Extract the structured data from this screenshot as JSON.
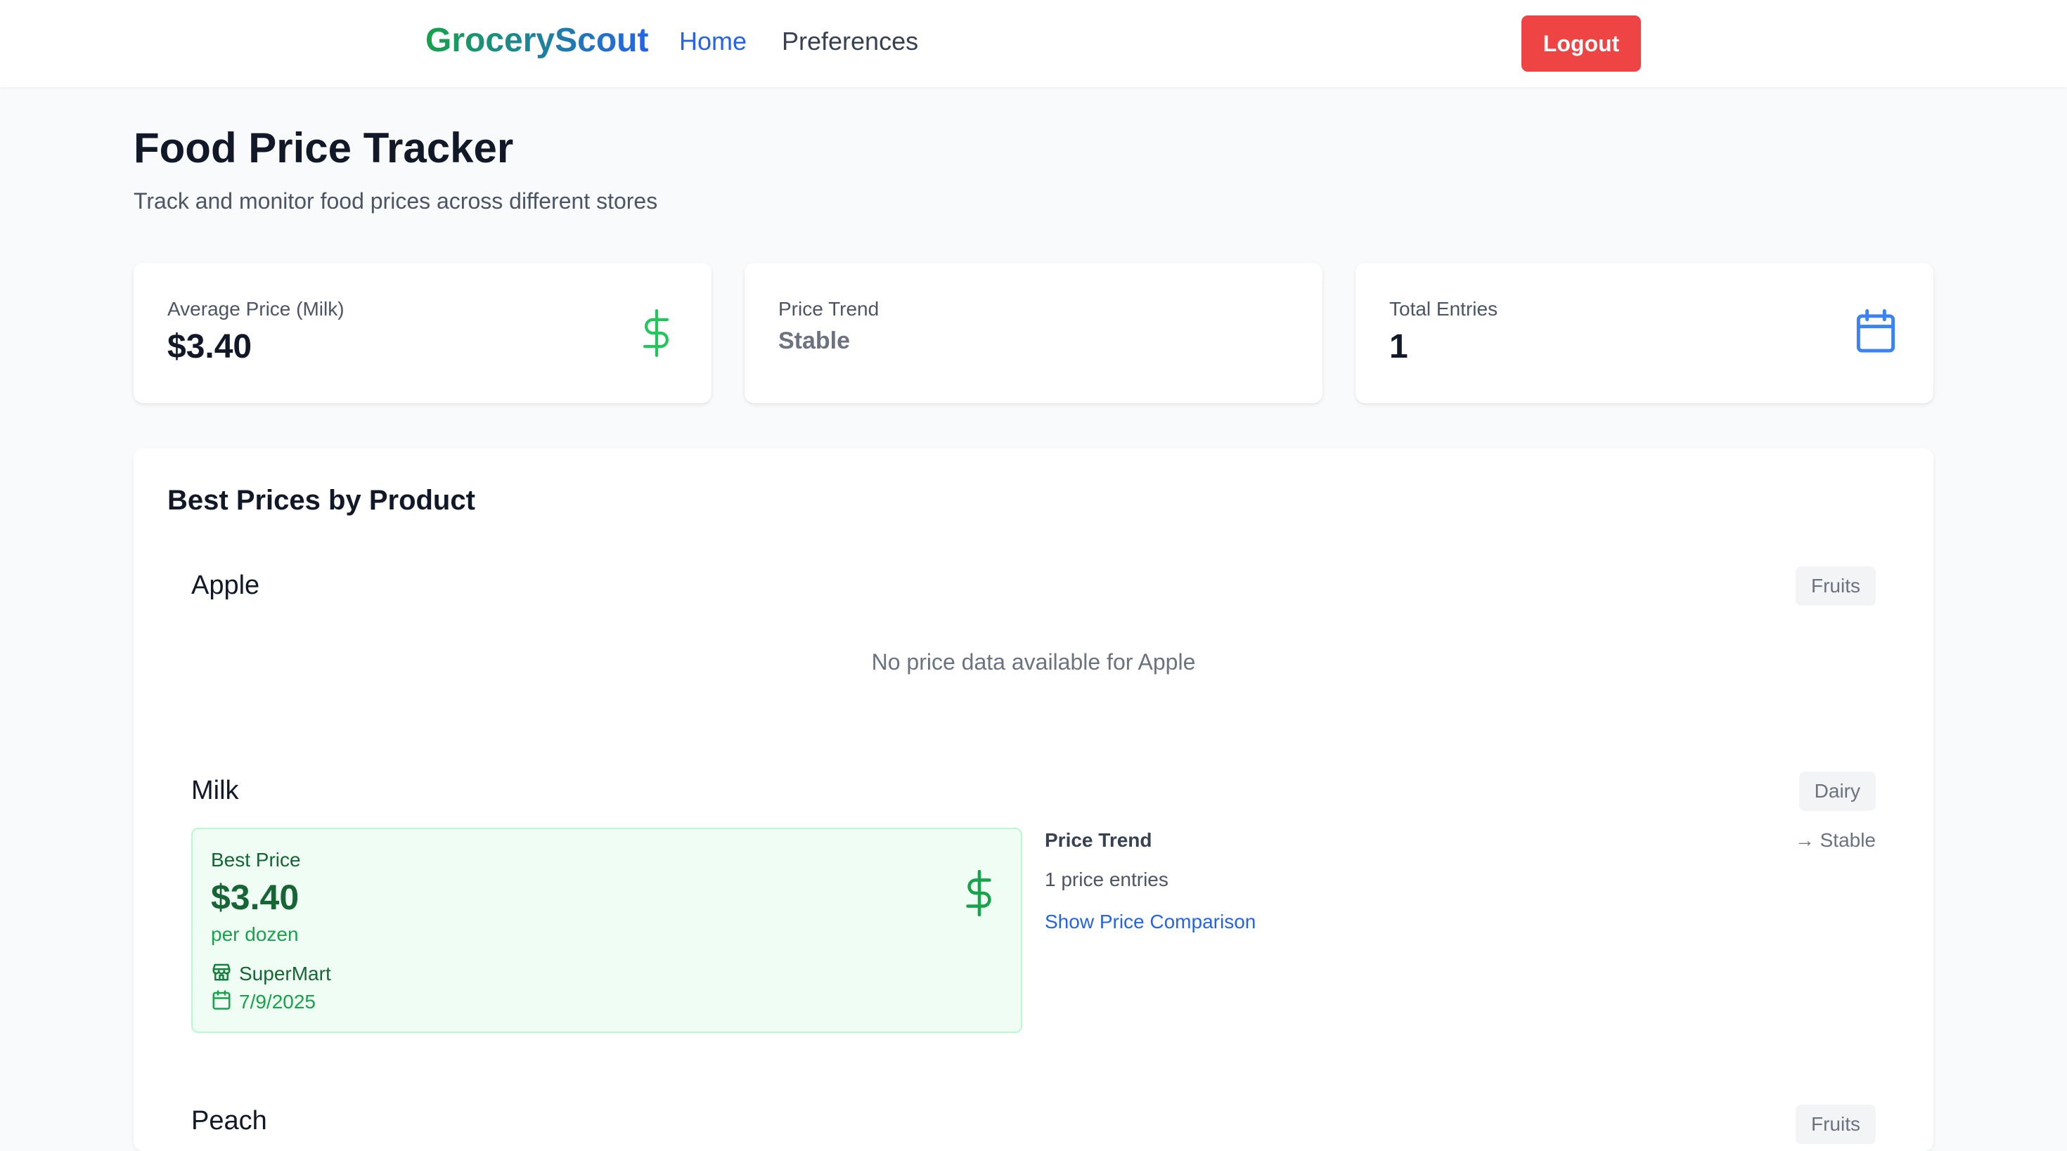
{
  "nav": {
    "brand": "GroceryScout",
    "links": [
      {
        "label": "Home",
        "active": true
      },
      {
        "label": "Preferences",
        "active": false
      }
    ],
    "logout_label": "Logout"
  },
  "header": {
    "title": "Food Price Tracker",
    "subtitle": "Track and monitor food prices across different stores"
  },
  "stats": [
    {
      "label": "Average Price (Milk)",
      "value": "$3.40",
      "icon": "dollar-icon"
    },
    {
      "label": "Price Trend",
      "value": "Stable"
    },
    {
      "label": "Total Entries",
      "value": "1",
      "icon": "calendar-icon"
    }
  ],
  "best_prices": {
    "title": "Best Prices by Product",
    "products": [
      {
        "name": "Apple",
        "category": "Fruits",
        "no_data_text": "No price data available for Apple"
      },
      {
        "name": "Milk",
        "category": "Dairy",
        "best_price_label": "Best Price",
        "best_price": "$3.40",
        "unit": "per dozen",
        "store": "SuperMart",
        "date": "7/9/2025",
        "trend_label": "Price Trend",
        "trend_value": "→ Stable",
        "entries_text": "1 price entries",
        "compare_link": "Show Price Comparison"
      },
      {
        "name": "Peach",
        "category": "Fruits"
      }
    ]
  },
  "colors": {
    "brand_green": "#16a34a",
    "brand_blue": "#2563eb",
    "logout_red": "#ef4444",
    "best_price_bg": "#f0fdf4"
  }
}
